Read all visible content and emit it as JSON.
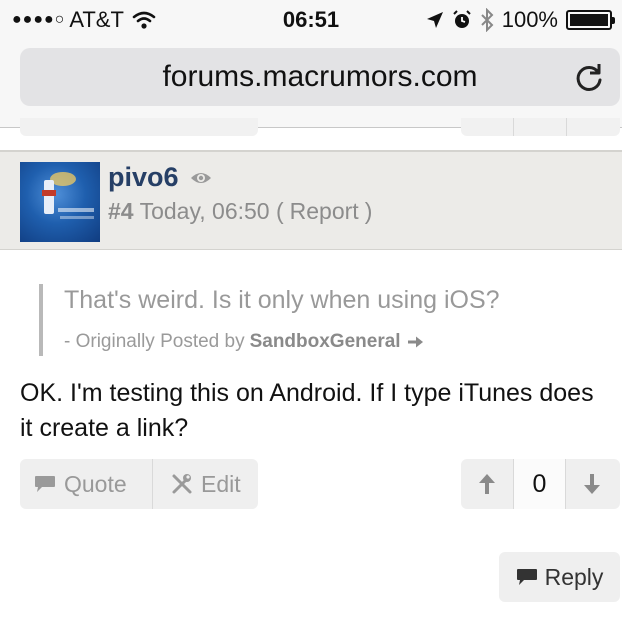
{
  "status_bar": {
    "signal": "●●●●○",
    "carrier": "AT&T",
    "time": "06:51",
    "battery": "100%",
    "icons": [
      "wifi-icon",
      "location-arrow-icon",
      "alarm-icon",
      "bluetooth-icon",
      "battery-icon"
    ]
  },
  "browser": {
    "url": "forums.macrumors.com",
    "reload_icon": "reload-icon"
  },
  "post": {
    "username": "pivo6",
    "post_number": "#4",
    "timestamp": "Today, 06:50",
    "report_open": "(",
    "report_label": "Report",
    "report_close": ")",
    "quote": {
      "text": "That's weird. Is it only when using iOS?",
      "attribution_prefix": "- Originally Posted by",
      "author": "SandboxGeneral"
    },
    "message": "OK. I'm testing this on Android. If I type iTunes does it create a link?",
    "actions": {
      "quote_label": "Quote",
      "edit_label": "Edit"
    },
    "vote_count": "0",
    "reply_label": "Reply"
  },
  "colors": {
    "username": "#263f66",
    "header_bg": "#ecebe8",
    "button_bg": "#efefef",
    "muted_text": "#999999"
  }
}
